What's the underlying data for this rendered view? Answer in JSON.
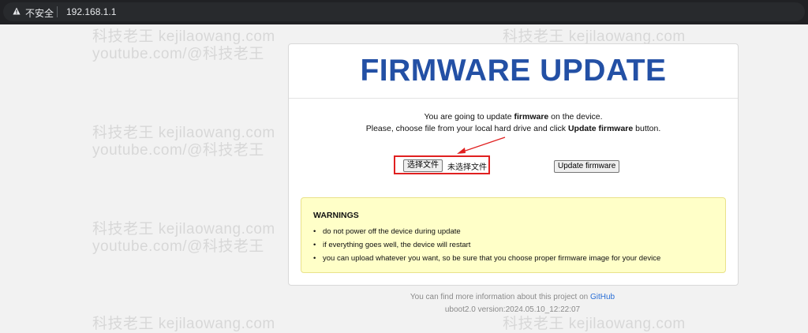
{
  "browser": {
    "security_label": "不安全",
    "url": "192.168.1.1"
  },
  "watermark": {
    "line1": "科技老王 kejilaowang.com",
    "line2": "youtube.com/@科技老王"
  },
  "card": {
    "title": "FIRMWARE UPDATE",
    "line1_pre": "You are going to update ",
    "line1_bold": "firmware",
    "line1_post": " on the device.",
    "line2_pre": "Please, choose file from your local hard drive and click ",
    "line2_bold": "Update firmware",
    "line2_post": " button.",
    "file_button": "选择文件",
    "file_status": "未选择文件",
    "update_button": "Update firmware"
  },
  "warnings": {
    "title": "WARNINGS",
    "items": [
      "do not power off the device during update",
      "if everything goes well, the device will restart",
      "you can upload whatever you want, so be sure that you choose proper firmware image for your device"
    ]
  },
  "footer": {
    "info_pre": "You can find more information about this project on ",
    "info_link": "GitHub",
    "version": "uboot2.0 version:2024.05.10_12:22:07"
  },
  "colors": {
    "title": "#2350a5",
    "highlight_border": "#e02020",
    "warning_bg": "#ffffc8",
    "link": "#2a6fd6"
  }
}
